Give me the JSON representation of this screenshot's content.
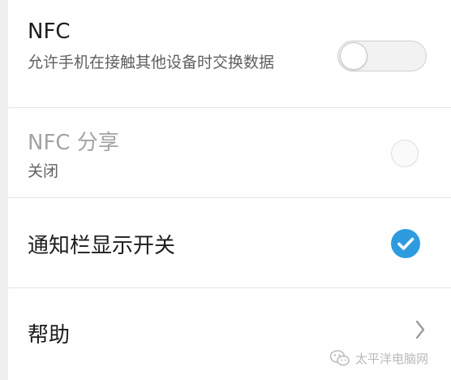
{
  "settings": {
    "nfc": {
      "title": "NFC",
      "description": "允许手机在接触其他设备时交换数据",
      "enabled": false
    },
    "nfc_share": {
      "title": "NFC 分享",
      "status": "关闭",
      "selected": false
    },
    "notification_toggle": {
      "title": "通知栏显示开关",
      "checked": true
    },
    "help": {
      "title": "帮助"
    }
  },
  "watermark": {
    "text": "太平洋电脑网",
    "icon": "wechat-icon"
  },
  "colors": {
    "accent": "#2e9be0",
    "title_text": "#1c1c1c",
    "secondary_text": "#5f5f5f",
    "disabled_text": "#a3a3a3"
  }
}
